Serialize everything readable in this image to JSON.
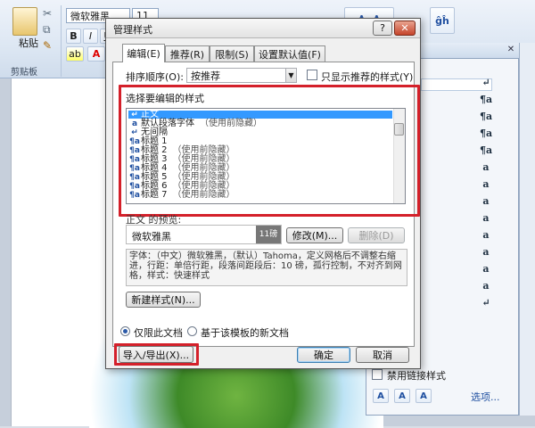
{
  "ribbon": {
    "paste_label": "粘贴",
    "clipboard_group": "剪贴板",
    "font_name": "微软雅黑",
    "font_size": "11",
    "bold": "B",
    "italic": "I",
    "underline": "U",
    "font_color": "A"
  },
  "pane": {
    "marks": [
      "↵",
      "¶a",
      "¶a",
      "¶a",
      "¶a",
      "a",
      "a",
      "a",
      "a",
      "a",
      "a",
      "a",
      "a",
      "↵"
    ],
    "disable_linked_label": "禁用链接样式",
    "options_link": "选项..."
  },
  "dialog": {
    "title": "管理样式",
    "help": "?",
    "close": "✕",
    "tabs": [
      "编辑(E)",
      "推荐(R)",
      "限制(S)",
      "设置默认值(F)"
    ],
    "sort_label": "排序顺序(O):",
    "sort_value": "按推荐",
    "only_recommended": "只显示推荐的样式(Y)",
    "select_style_label": "选择要编辑的样式",
    "styles": [
      {
        "icon": "↵",
        "name": "正文",
        "note": ""
      },
      {
        "icon": "a",
        "name": "默认段落字体",
        "note": "（使用前隐藏）"
      },
      {
        "icon": "↵",
        "name": "无间隔",
        "note": ""
      },
      {
        "icon": "¶a",
        "name": "标题 1",
        "note": ""
      },
      {
        "icon": "¶a",
        "name": "标题 2",
        "note": "（使用前隐藏）"
      },
      {
        "icon": "¶a",
        "name": "标题 3",
        "note": "（使用前隐藏）"
      },
      {
        "icon": "¶a",
        "name": "标题 4",
        "note": "（使用前隐藏）"
      },
      {
        "icon": "¶a",
        "name": "标题 5",
        "note": "（使用前隐藏）"
      },
      {
        "icon": "¶a",
        "name": "标题 6",
        "note": "（使用前隐藏）"
      },
      {
        "icon": "¶a",
        "name": "标题 7",
        "note": "（使用前隐藏）"
      }
    ],
    "preview_label": "正文 的预览:",
    "preview_font": "微软雅黑",
    "preview_size": "11磅",
    "modify_button": "修改(M)...",
    "delete_button": "删除(D)",
    "description": "字体：（中文）微软雅黑，（默认）Tahoma，定义网格后不调整右缩进，行距：单倍行距，段落间距段后：10 磅，孤行控制，不对齐到网格，样式：快速样式",
    "new_style_button": "新建样式(N)...",
    "radio_this_doc": "仅限此文档",
    "radio_template": "基于该模板的新文档",
    "import_export_button": "导入/导出(X)...",
    "ok_button": "确定",
    "cancel_button": "取消"
  },
  "colors": {
    "highlight_box": "#d4202a",
    "selection": "#3399ff"
  }
}
